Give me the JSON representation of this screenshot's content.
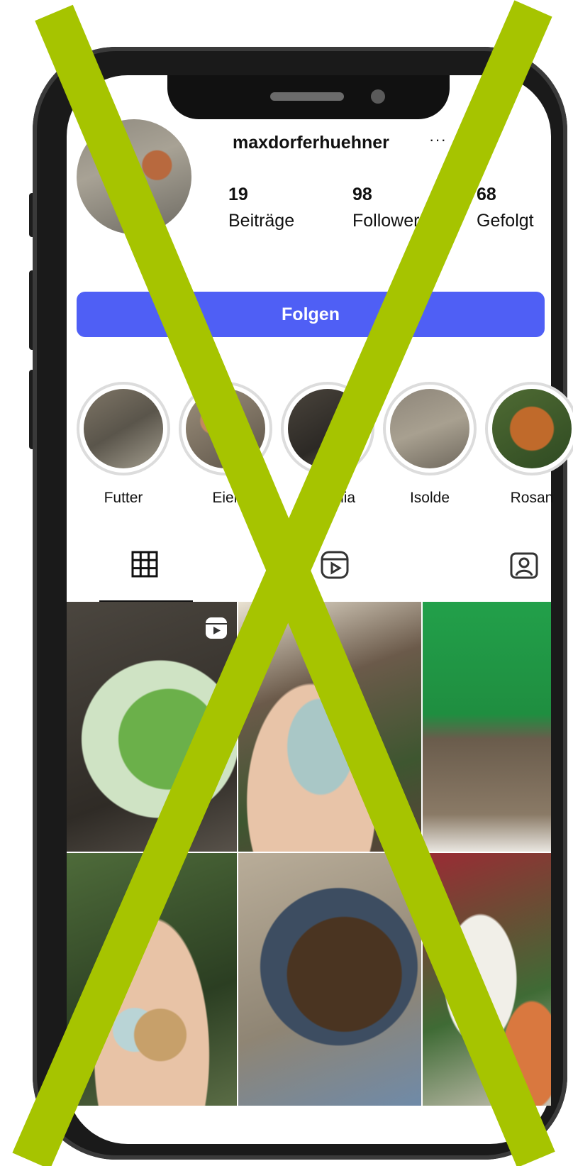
{
  "profile": {
    "username": "maxdorferhuehner",
    "more_label": "···",
    "stats": [
      {
        "value": "19",
        "label": "Beiträge"
      },
      {
        "value": "98",
        "label": "Follower"
      },
      {
        "value": "68",
        "label": "Gefolgt"
      }
    ],
    "follow_label": "Folgen"
  },
  "highlights": [
    {
      "label": "Futter"
    },
    {
      "label": "Eier"
    },
    {
      "label": "Cornelia"
    },
    {
      "label": "Isolde"
    },
    {
      "label": "Rosan"
    }
  ],
  "tabs": [
    {
      "icon": "grid-icon"
    },
    {
      "icon": "reels-icon"
    },
    {
      "icon": "tagged-icon"
    }
  ],
  "colors": {
    "follow_button": "#4f5ff5",
    "overlay_x": "#a6c400"
  }
}
